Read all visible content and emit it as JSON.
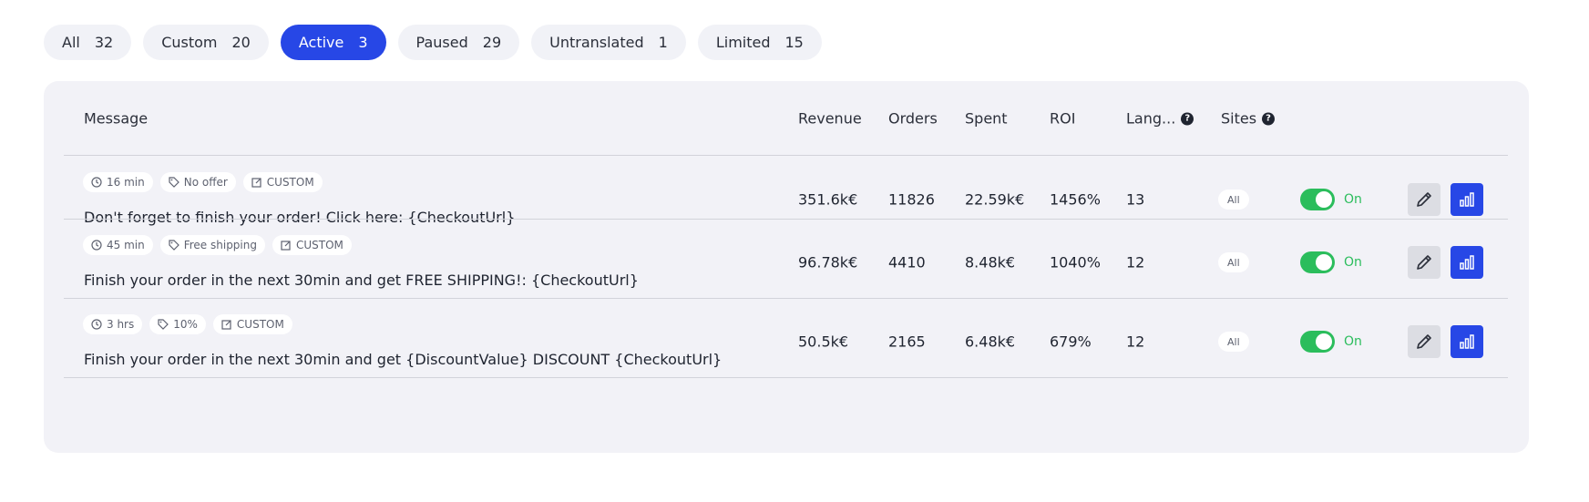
{
  "tabs": [
    {
      "label": "All",
      "count": "32"
    },
    {
      "label": "Custom",
      "count": "20"
    },
    {
      "label": "Active",
      "count": "3"
    },
    {
      "label": "Paused",
      "count": "29"
    },
    {
      "label": "Untranslated",
      "count": "1"
    },
    {
      "label": "Limited",
      "count": "15"
    }
  ],
  "active_tab": "Active",
  "columns": {
    "message": "Message",
    "revenue": "Revenue",
    "orders": "Orders",
    "spent": "Spent",
    "roi": "ROI",
    "languages": "Lang...",
    "sites": "Sites"
  },
  "rows": [
    {
      "delay": "16 min",
      "offer": "No offer",
      "type": "CUSTOM",
      "message": "Don't forget to finish your order! Click here: {CheckoutUrl}",
      "revenue": "351.6k€",
      "orders": "11826",
      "spent": "22.59k€",
      "roi": "1456%",
      "languages": "13",
      "sites": "All",
      "status": "On"
    },
    {
      "delay": "45 min",
      "offer": "Free shipping",
      "type": "CUSTOM",
      "message": "Finish your order in the next 30min and get FREE SHIPPING!: {CheckoutUrl}",
      "revenue": "96.78k€",
      "orders": "4410",
      "spent": "8.48k€",
      "roi": "1040%",
      "languages": "12",
      "sites": "All",
      "status": "On"
    },
    {
      "delay": "3 hrs",
      "offer": "10%",
      "type": "CUSTOM",
      "message": "Finish your order in the next 30min and get {DiscountValue} DISCOUNT {CheckoutUrl}",
      "revenue": "50.5k€",
      "orders": "2165",
      "spent": "6.48k€",
      "roi": "679%",
      "languages": "12",
      "sites": "All",
      "status": "On"
    }
  ],
  "colors": {
    "accent": "#2747e6",
    "toggle_on": "#2bbd5c",
    "panel_bg": "#f2f2f7"
  },
  "icons": {
    "delay": "clock-icon",
    "offer": "tag-icon",
    "type": "edit-note-icon",
    "edit": "pencil-icon",
    "stats": "bar-chart-icon",
    "help": "question-circle-icon"
  }
}
